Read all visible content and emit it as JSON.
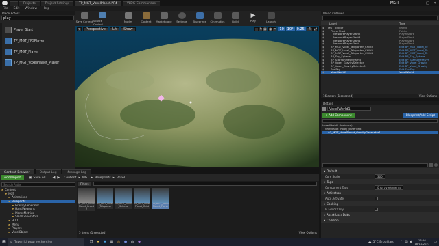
{
  "window": {
    "tabs": [
      {
        "label": "",
        "active": false
      },
      {
        "label": "Projects",
        "active": false
      },
      {
        "label": "Project Settings",
        "active": false
      },
      {
        "label": "TP_MGT_VoxelPlanet.PP4",
        "active": true
      },
      {
        "label": "VLDG Commandos",
        "active": false
      }
    ],
    "title": "MGT"
  },
  "menu": [
    "File",
    "Edit",
    "Window",
    "Help"
  ],
  "place_actors": {
    "title": "Place Actors",
    "search_value": "play",
    "items": [
      {
        "label": "Player Start"
      },
      {
        "label": "TP_MGT_FPSPlayer"
      },
      {
        "label": "TP_MGT_Player"
      },
      {
        "label": "TP_MGT_VoxelPlanet_Player"
      }
    ]
  },
  "toolbar": {
    "buttons": [
      {
        "label": "Save Current",
        "icon": "save-icon"
      },
      {
        "label": "Source Control",
        "icon": "source-control-icon"
      },
      {
        "label": "Modes",
        "icon": "modes-icon"
      },
      {
        "label": "Content",
        "icon": "content-icon"
      },
      {
        "label": "Marketplace",
        "icon": "marketplace-icon"
      },
      {
        "label": "Settings",
        "icon": "settings-icon"
      },
      {
        "label": "Blueprints",
        "icon": "blueprints-icon"
      },
      {
        "label": "Cinematics",
        "icon": "cinematics-icon"
      },
      {
        "label": "Build",
        "icon": "build-icon"
      },
      {
        "label": "Play",
        "icon": "play-icon"
      },
      {
        "label": "Launch",
        "icon": "launch-icon"
      }
    ]
  },
  "viewport": {
    "perspective": "Perspective",
    "lit": "Lit",
    "show": "Show",
    "grid_snap": "10",
    "rot_snap": "10°",
    "scale_snap": "0.25",
    "camera_speed": "4"
  },
  "outliner": {
    "title": "World Outliner",
    "col_label": "Label",
    "col_type": "Type",
    "rows": [
      {
        "label": "MGT (Editor)",
        "type": "World",
        "indent": 0
      },
      {
        "label": "PlayerStart",
        "type": "Folder",
        "indent": 1
      },
      {
        "label": "NetworkPlayerStart2",
        "type": "PlayerStart",
        "indent": 2
      },
      {
        "label": "NetworkPlayerStart3",
        "type": "PlayerStart",
        "indent": 2
      },
      {
        "label": "NetworkPlayerStart4",
        "type": "PlayerStart",
        "indent": 2
      },
      {
        "label": "NetworkPlayerStart",
        "type": "PlayerStart",
        "indent": 2
      },
      {
        "label": "BP_MGT_Voxel_Teleporter_Child3",
        "type": "Edit BP_MGT_Voxel_Te",
        "indent": 1
      },
      {
        "label": "BP_MGT_Voxel_Teleporter_Child2",
        "type": "Edit BP_MGT_Voxel_Te",
        "indent": 1
      },
      {
        "label": "BP_MGT_Voxel_Teleporter_Child4",
        "type": "Edit BP_MGT_Voxel_Te",
        "indent": 1
      },
      {
        "label": "BP_Sky_Sphere",
        "type": "Edit BP_Sky_Sphere",
        "indent": 1
      },
      {
        "label": "BP_StarSphereDynamic",
        "type": "Edit BP_StarSphereDyn",
        "indent": 1
      },
      {
        "label": "BP_Voxel_GravitySelector",
        "type": "Edit BP_Voxel_Gravity",
        "indent": 1
      },
      {
        "label": "BP_Voxel_GravitySelector3",
        "type": "Edit BP_Voxel_Gravity",
        "indent": 1
      },
      {
        "label": "SunSky",
        "type": "Edit SunSky",
        "indent": 1
      },
      {
        "label": "VoxelWorld1",
        "type": "VoxelWorld",
        "indent": 1,
        "selected": true
      }
    ],
    "footer_count": "16 actors (1 selected)",
    "view_options": "View Options"
  },
  "details": {
    "title": "Details",
    "name_value": "VoxelWorld1",
    "add_component": "+ Add Component",
    "blueprint_script": "Blueprint/Add Script",
    "search_placeholder": "Search Components",
    "instance_label": "VoxelWorld1 (Instance)",
    "tree_items": [
      {
        "label": "WorldRoot (Root) (Inherited)"
      },
      {
        "label": "AC_MGT_VoxelPlanet_GravityGenerator1"
      }
    ],
    "details_search_placeholder": "Search Details",
    "sections": [
      {
        "title": "Default",
        "props": [
          {
            "name": "Core Scale",
            "value": "360"
          }
        ]
      },
      {
        "title": "Tags",
        "props": [
          {
            "name": "Component Tags",
            "value": "0 Array elements"
          }
        ]
      },
      {
        "title": "Activation",
        "props": [
          {
            "name": "Auto Activate",
            "value": ""
          }
        ]
      },
      {
        "title": "Cooking",
        "props": [
          {
            "name": "Is Editor Only",
            "value": ""
          }
        ]
      },
      {
        "title": "Asset User Data",
        "props": []
      },
      {
        "title": "Collision",
        "props": []
      }
    ]
  },
  "content_browser": {
    "tabs": [
      "Content Browser",
      "Output Log",
      "Message Log"
    ],
    "add_import": "Add/Import",
    "save_all": "Save All",
    "breadcrumb": [
      "Content",
      "MGT",
      "Blueprints",
      "Voxel"
    ],
    "search_paths": "Search Paths",
    "filters": "Filters",
    "search_placeholder": "Search Voxel",
    "tree": [
      {
        "label": "Content",
        "indent": 0
      },
      {
        "label": "MGT",
        "indent": 1
      },
      {
        "label": "Animations",
        "indent": 2
      },
      {
        "label": "Blueprints",
        "indent": 2,
        "selected": true
      },
      {
        "label": "GravityGenerator",
        "indent": 3
      },
      {
        "label": "HandWeapons",
        "indent": 3
      },
      {
        "label": "PlanetMetrics",
        "indent": 3
      },
      {
        "label": "SmallGenerators",
        "indent": 3
      },
      {
        "label": "HUD",
        "indent": 2
      },
      {
        "label": "Menu",
        "indent": 2
      },
      {
        "label": "Players",
        "indent": 2
      },
      {
        "label": "VoxelObject",
        "indent": 2
      }
    ],
    "assets": [
      {
        "label": "AC_MGT_VoxelPlanet_Gravity",
        "color": "#8a8a8a"
      },
      {
        "label": "BP_MGT_Voxel_Teleporter",
        "color": "#5e8fb8"
      },
      {
        "label": "BP_MGT_Voxel_Selector",
        "color": "#5e8fb8"
      },
      {
        "label": "BP_MGT_VoxelPlanet_Child",
        "color": "#5e8fb8"
      },
      {
        "label": "TP_MGT_VoxelPlanet_Player",
        "color": "#5e8fb8"
      }
    ],
    "footer": "5 items (1 selected)",
    "view_options": "View Options"
  },
  "taskbar": {
    "search_placeholder": "Taper ici pour rechercher",
    "weather": "5°C  Brouillard",
    "time": "16:56",
    "date": "18/11/2021"
  }
}
